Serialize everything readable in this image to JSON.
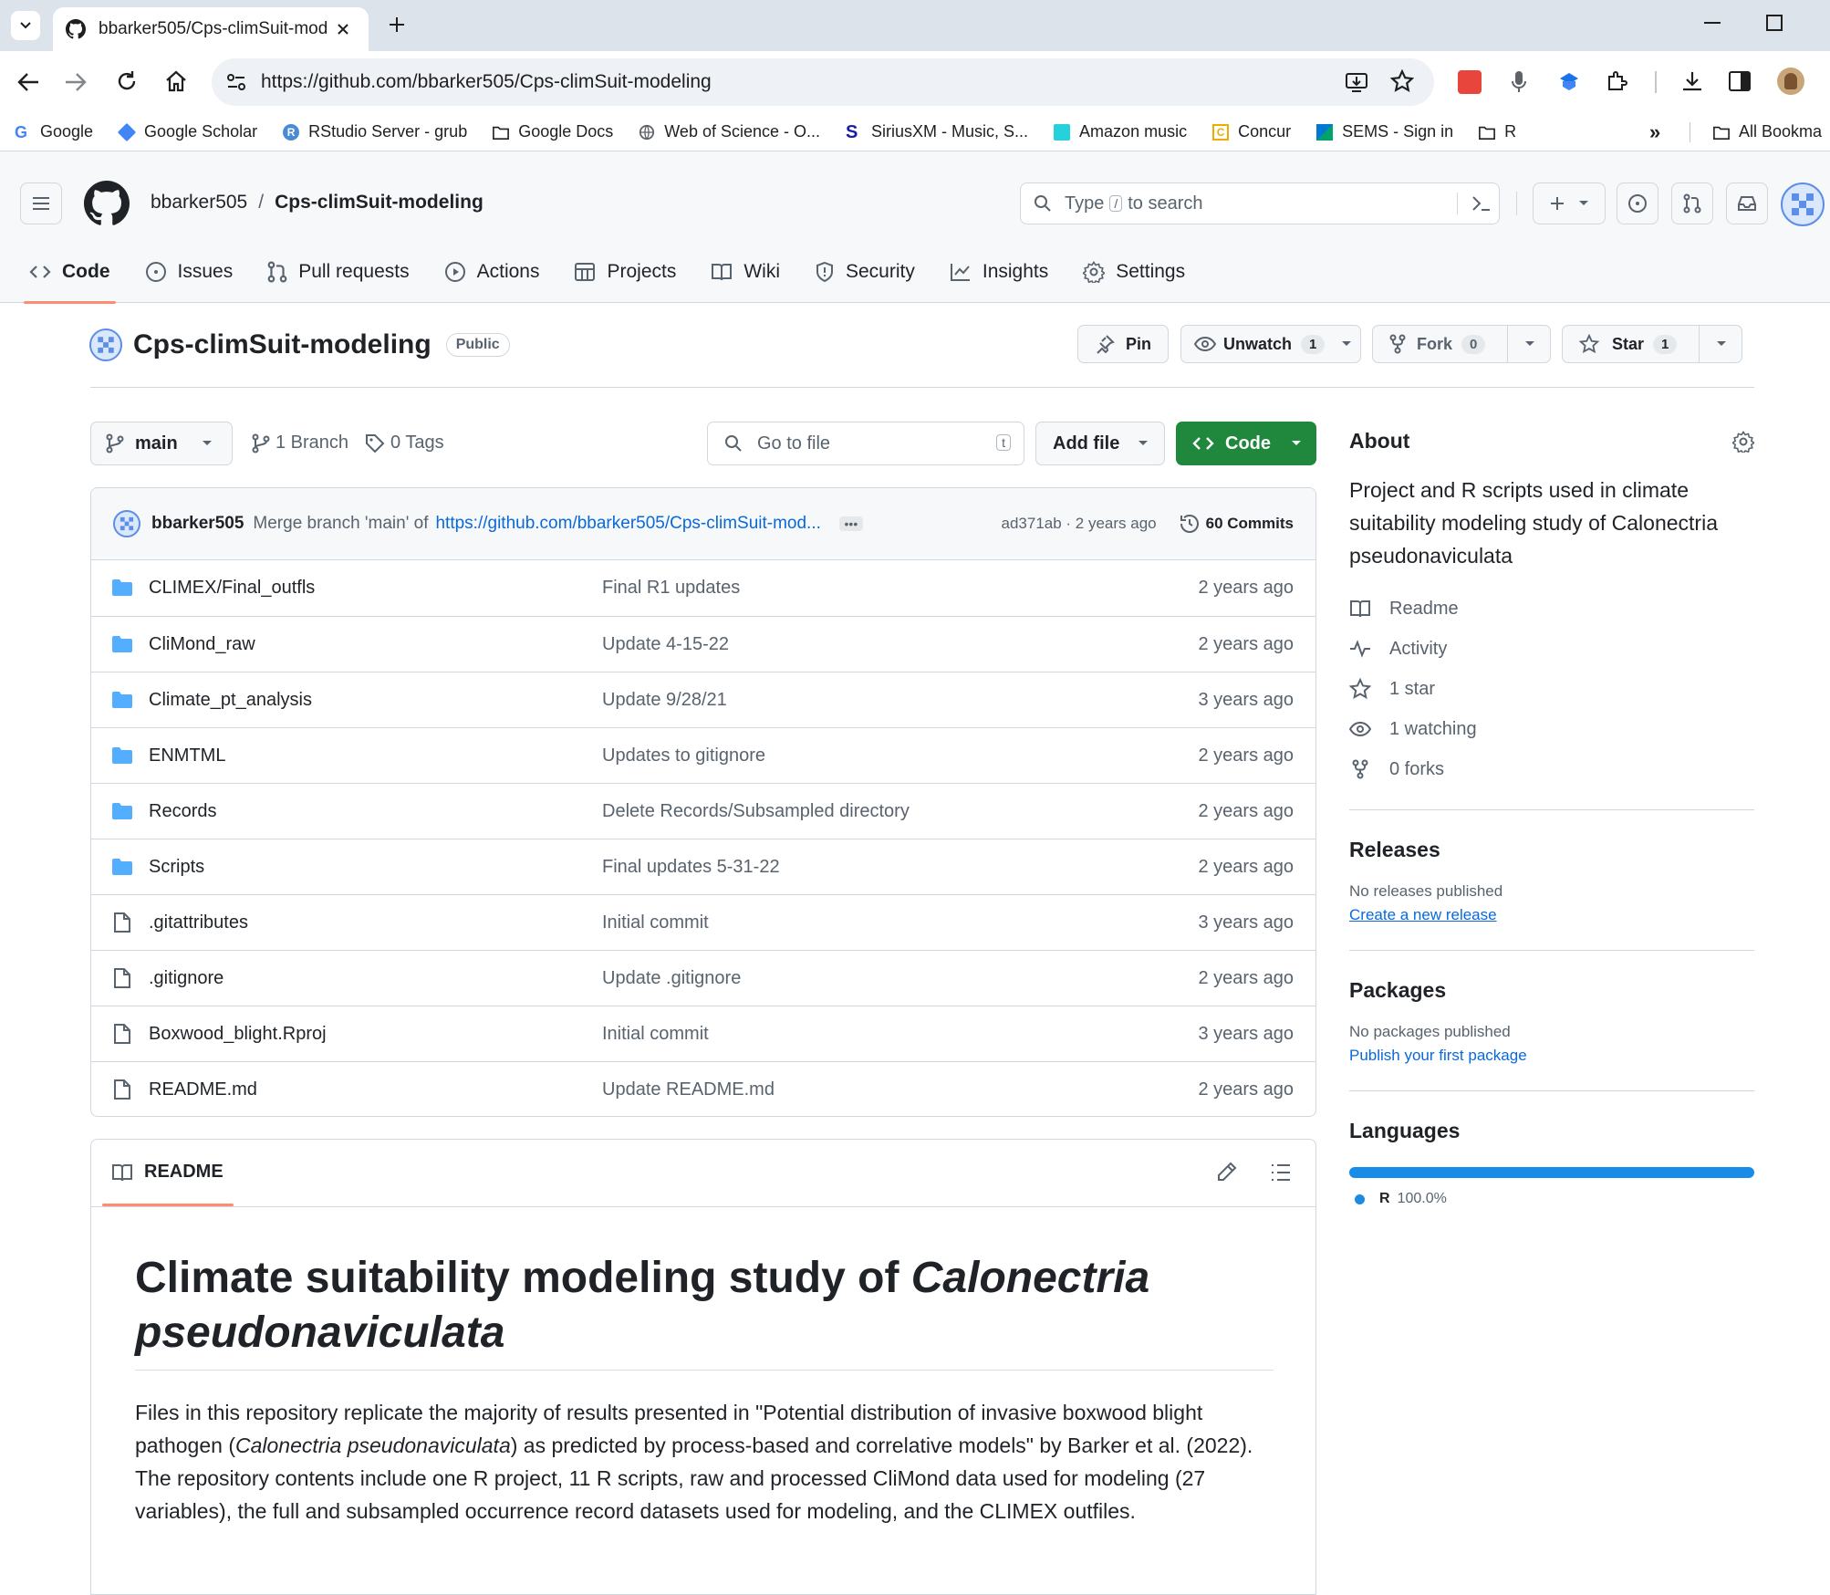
{
  "browser": {
    "tab_title": "bbarker505/Cps-climSuit-modeling",
    "url": "https://github.com/bbarker505/Cps-climSuit-modeling",
    "bookmarks": [
      {
        "label": "Google",
        "icon": "google-icon"
      },
      {
        "label": "Google Scholar",
        "icon": "scholar-icon"
      },
      {
        "label": "RStudio Server - grub",
        "icon": "rstudio-icon"
      },
      {
        "label": "Google Docs",
        "icon": "folder-icon"
      },
      {
        "label": "Web of Science - O...",
        "icon": "globe-icon"
      },
      {
        "label": "SiriusXM - Music, S...",
        "icon": "siriusxm-icon"
      },
      {
        "label": "Amazon music",
        "icon": "amazon-music-icon"
      },
      {
        "label": "Concur",
        "icon": "concur-icon"
      },
      {
        "label": "SEMS - Sign in",
        "icon": "sems-icon"
      },
      {
        "label": "R",
        "icon": "folder-icon"
      }
    ],
    "all_bookmarks": "All Bookma"
  },
  "gh": {
    "owner": "bbarker505",
    "separator": "/",
    "repo": "Cps-climSuit-modeling",
    "search_placeholder_pre": "Type",
    "search_key": "/",
    "search_placeholder_post": "to search",
    "nav": [
      {
        "label": "Code",
        "icon": "code-icon",
        "active": true
      },
      {
        "label": "Issues",
        "icon": "issue-icon"
      },
      {
        "label": "Pull requests",
        "icon": "pull-request-icon"
      },
      {
        "label": "Actions",
        "icon": "play-icon"
      },
      {
        "label": "Projects",
        "icon": "table-icon"
      },
      {
        "label": "Wiki",
        "icon": "book-icon"
      },
      {
        "label": "Security",
        "icon": "shield-icon"
      },
      {
        "label": "Insights",
        "icon": "graph-icon"
      },
      {
        "label": "Settings",
        "icon": "gear-icon"
      }
    ]
  },
  "repo": {
    "title": "Cps-climSuit-modeling",
    "visibility": "Public",
    "pin": "Pin",
    "unwatch": "Unwatch",
    "watch_count": "1",
    "fork": "Fork",
    "fork_count": "0",
    "star": "Star",
    "star_count": "1",
    "branch": "main",
    "branches": "1 Branch",
    "tags": "0 Tags",
    "go_to_file": "Go to file",
    "go_to_file_key": "t",
    "add_file": "Add file",
    "code_btn": "Code"
  },
  "commit": {
    "author": "bbarker505",
    "message_pre": "Merge branch 'main' of",
    "message_link": "https://github.com/bbarker505/Cps-climSuit-mod...",
    "hash_age": "ad371ab · 2 years ago",
    "commits": "60 Commits"
  },
  "files": [
    {
      "name": "CLIMEX/Final_outfls",
      "type": "dir",
      "msg": "Final R1 updates",
      "age": "2 years ago"
    },
    {
      "name": "CliMond_raw",
      "type": "dir",
      "msg": "Update 4-15-22",
      "age": "2 years ago"
    },
    {
      "name": "Climate_pt_analysis",
      "type": "dir",
      "msg": "Update 9/28/21",
      "age": "3 years ago"
    },
    {
      "name": "ENMTML",
      "type": "dir",
      "msg": "Updates to gitignore",
      "age": "2 years ago"
    },
    {
      "name": "Records",
      "type": "dir",
      "msg": "Delete Records/Subsampled directory",
      "age": "2 years ago"
    },
    {
      "name": "Scripts",
      "type": "dir",
      "msg": "Final updates 5-31-22",
      "age": "2 years ago"
    },
    {
      "name": ".gitattributes",
      "type": "file",
      "msg": "Initial commit",
      "age": "3 years ago"
    },
    {
      "name": ".gitignore",
      "type": "file",
      "msg": "Update .gitignore",
      "age": "2 years ago"
    },
    {
      "name": "Boxwood_blight.Rproj",
      "type": "file",
      "msg": "Initial commit",
      "age": "3 years ago"
    },
    {
      "name": "README.md",
      "type": "file",
      "msg": "Update README.md",
      "age": "2 years ago"
    }
  ],
  "about": {
    "heading": "About",
    "description": "Project and R scripts used in climate suitability modeling study of Calonectria pseudonaviculata",
    "readme": "Readme",
    "activity": "Activity",
    "stars": "1 star",
    "watching": "1 watching",
    "forks": "0 forks"
  },
  "releases": {
    "heading": "Releases",
    "none": "No releases published",
    "link": "Create a new release"
  },
  "packages": {
    "heading": "Packages",
    "none": "No packages published",
    "link": "Publish your first package"
  },
  "languages": {
    "heading": "Languages",
    "items": [
      {
        "name": "R",
        "percent": "100.0%",
        "color": "#198CE7",
        "fraction": 1.0
      }
    ]
  },
  "readme": {
    "tab": "README",
    "h1_plain": "Climate suitability modeling study of",
    "h1_italic_1": "Calonectria",
    "h1_italic_2": "pseudonaviculata",
    "p_1": "Files in this repository replicate the majority of results presented in \"Potential distribution of invasive boxwood blight pathogen (",
    "p_italic": "Calonectria pseudonaviculata",
    "p_2": ") as predicted by process-based and correlative models\" by Barker et al. (2022). The repository contents include one R project, 11 R scripts, raw and processed CliMond data used for modeling (27 variables), the full and subsampled occurrence record datasets used for modeling, and the CLIMEX outfiles."
  },
  "colors": {
    "accent": "#0969da",
    "green": "#1f883d",
    "folder": "#54aeff",
    "nav_underline": "#fd8c73"
  }
}
